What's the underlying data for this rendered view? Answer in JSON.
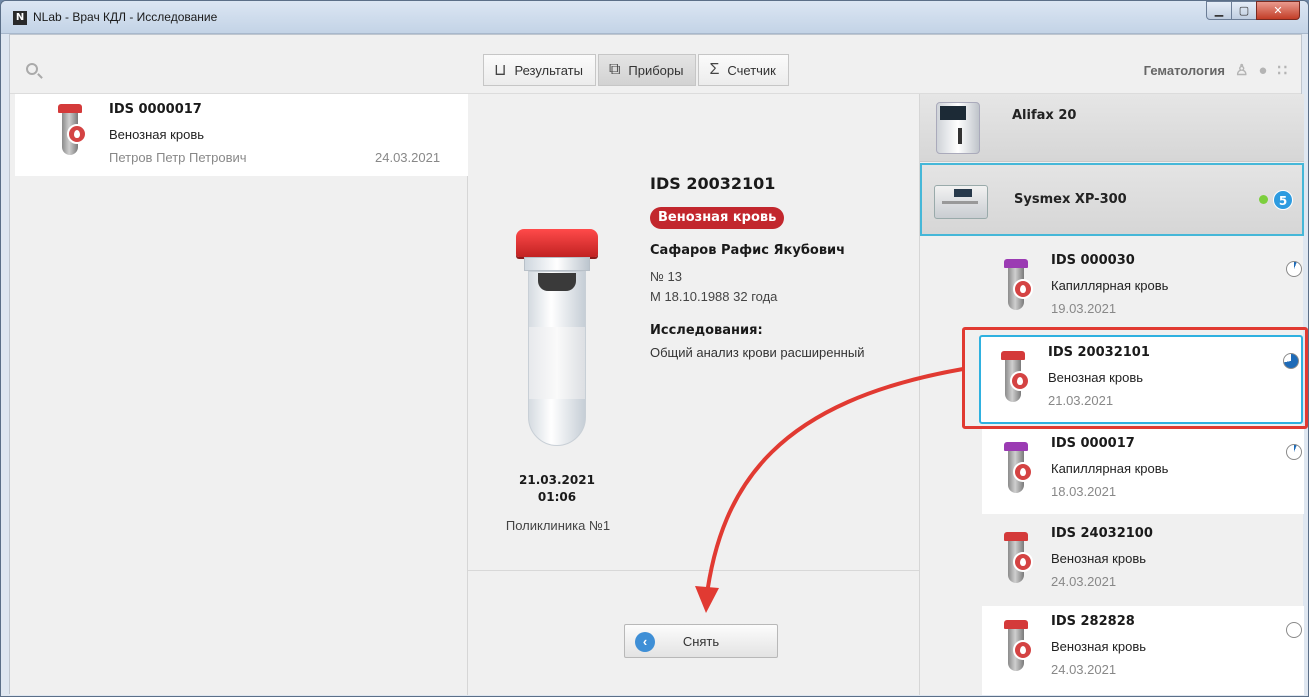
{
  "window": {
    "title": "NLab - Врач КДЛ - Исследование",
    "app_icon": "N"
  },
  "toolbar": {
    "tabs": [
      {
        "label": "Результаты",
        "icon": "test-tube-icon"
      },
      {
        "label": "Приборы",
        "icon": "devices-icon"
      },
      {
        "label": "Счетчик",
        "icon": "sigma-icon"
      }
    ],
    "department": "Гематология"
  },
  "left": {
    "card": {
      "id": "IDS 0000017",
      "type": "Венозная кровь",
      "patient": "Петров Петр Петрович",
      "date": "24.03.2021"
    }
  },
  "detail": {
    "id": "IDS 20032101",
    "badge": "Венозная кровь",
    "patient": "Сафаров Рафис Якубович",
    "number": "№ 13",
    "birth": "М 18.10.1988 32 года",
    "studies_label": "Исследования:",
    "studies": "Общий анализ крови расширенный",
    "date": "21.03.2021",
    "time": "01:06",
    "clinic": "Поликлиника №1",
    "button": "Снять"
  },
  "devices": [
    {
      "name": "Alifax 20"
    },
    {
      "name": "Sysmex XP-300",
      "count": "5",
      "online": true
    }
  ],
  "samples": [
    {
      "id": "IDS 000030",
      "type": "Капиллярная кровь",
      "date": "19.03.2021",
      "cap": "purple",
      "status": "p1"
    },
    {
      "id": "IDS 20032101",
      "type": "Венозная кровь",
      "date": "21.03.2021",
      "cap": "red",
      "status": "p3"
    },
    {
      "id": "IDS 000017",
      "type": "Капиллярная кровь",
      "date": "18.03.2021",
      "cap": "purple",
      "status": "p1"
    },
    {
      "id": "IDS 24032100",
      "type": "Венозная кровь",
      "date": "24.03.2021",
      "cap": "red",
      "status": "none"
    },
    {
      "id": "IDS 282828",
      "type": "Венозная кровь",
      "date": "24.03.2021",
      "cap": "red",
      "status": "empty"
    }
  ],
  "colors": {
    "accent": "#2fb1e0",
    "highlight": "#e13a32",
    "badge": "#c2272d",
    "online": "#7ccf3d"
  }
}
